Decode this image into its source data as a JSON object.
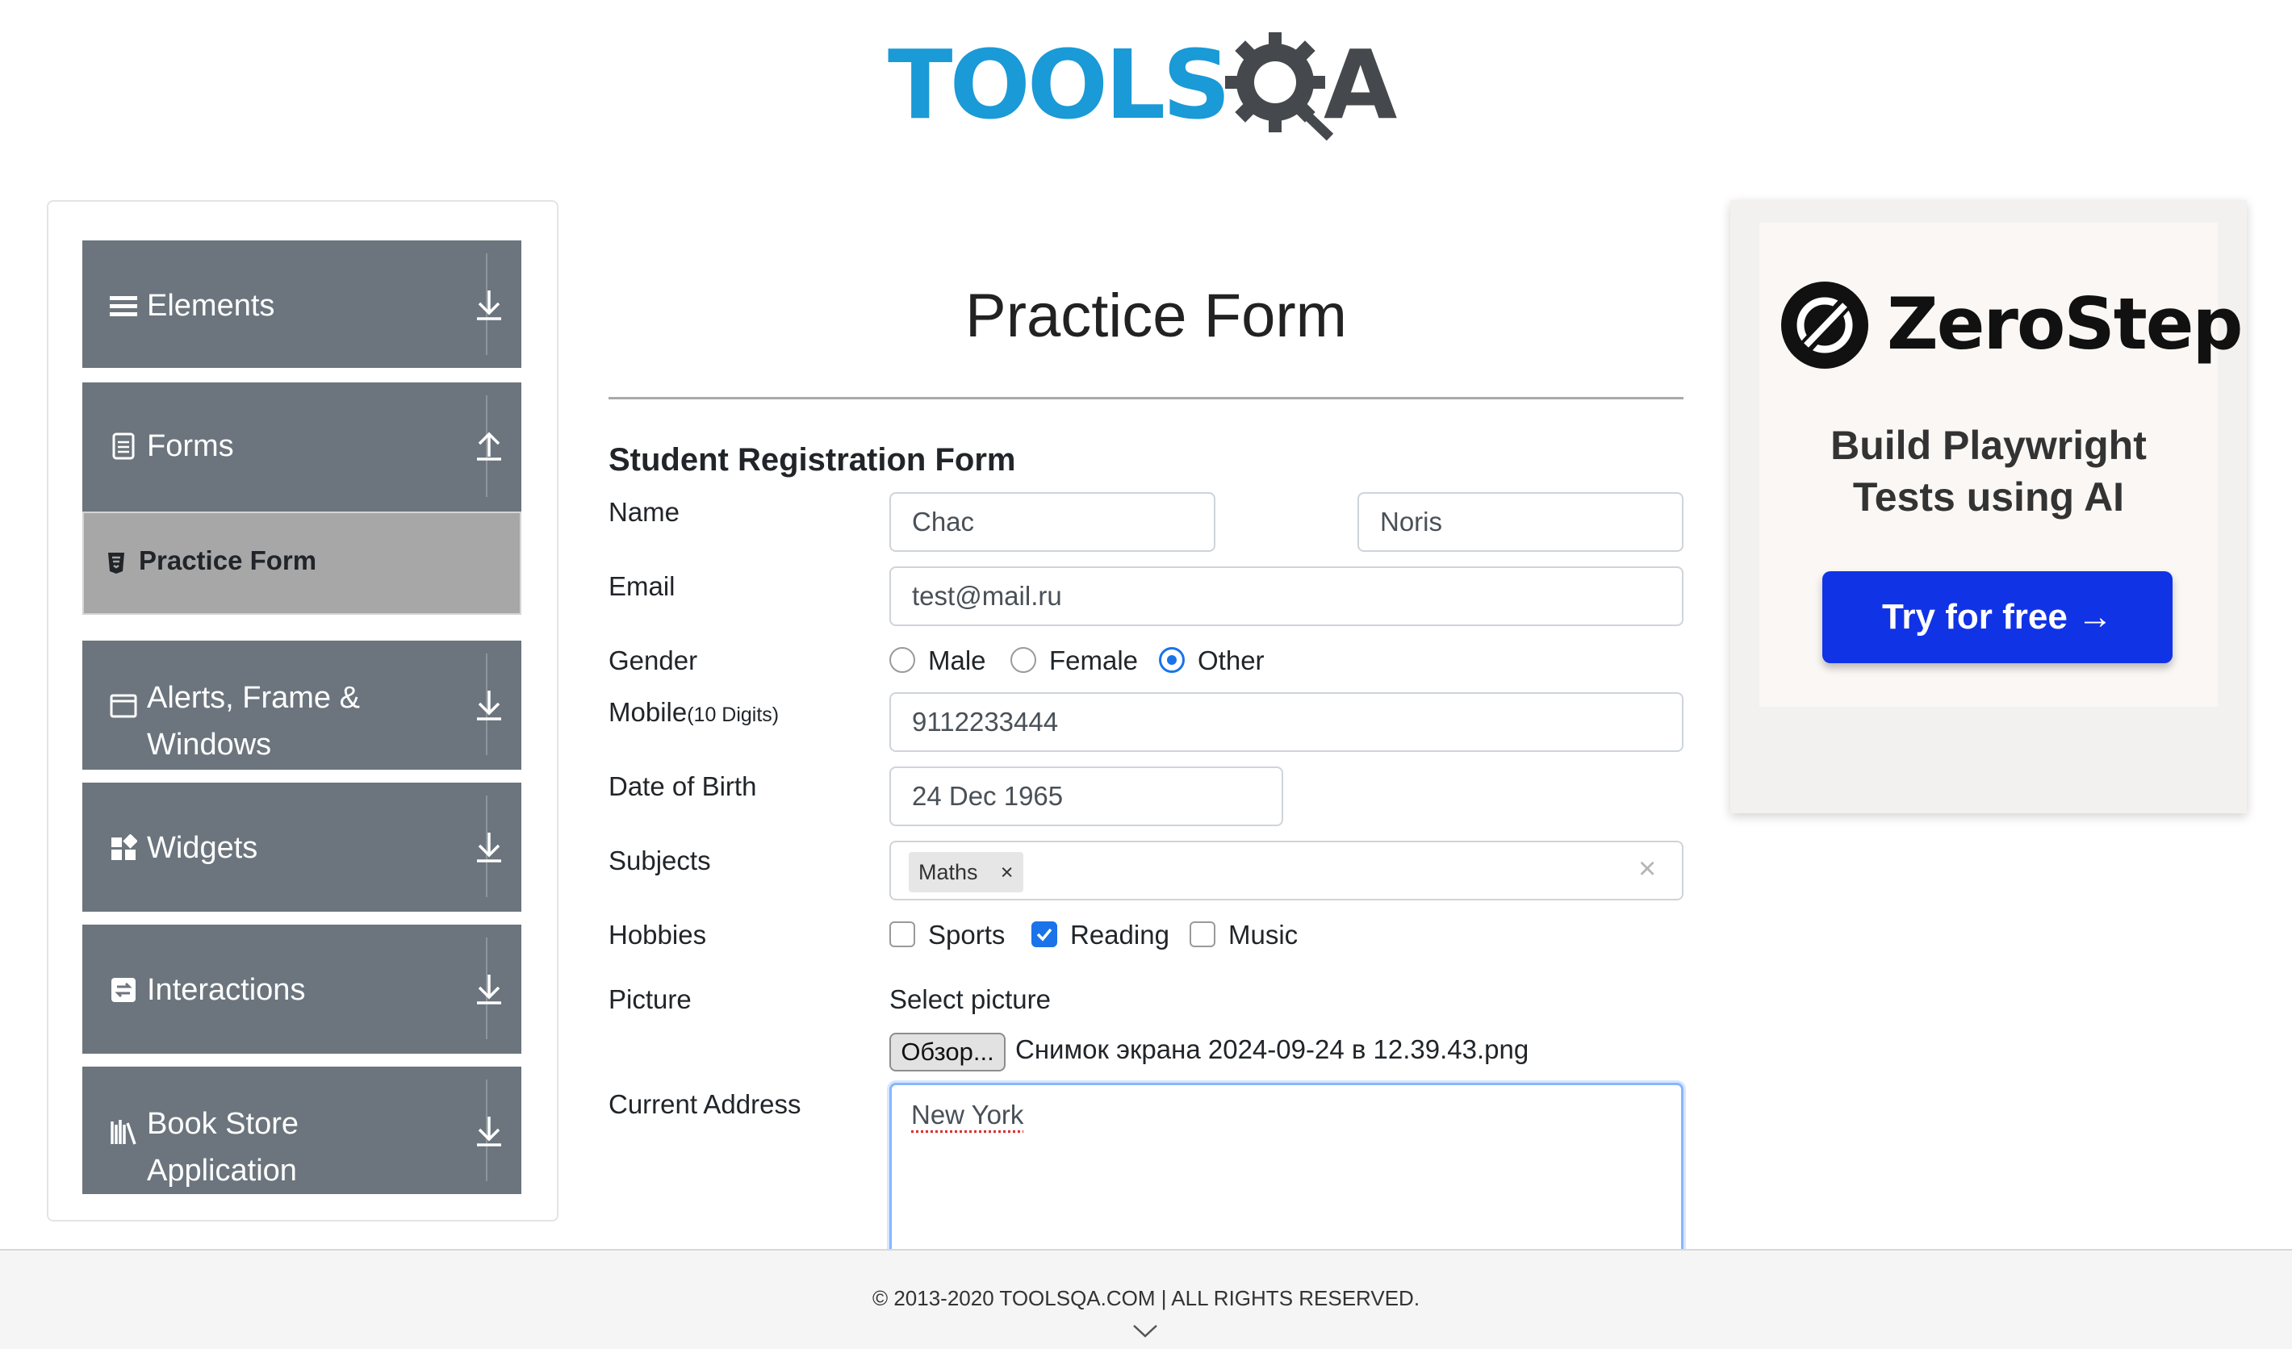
{
  "header": {
    "logo_text_left": "TOOLS",
    "logo_text_right": "A",
    "logo_alt": "TOOLSQA"
  },
  "sidebar": {
    "groups": [
      {
        "label": "Elements",
        "icon": "hamburger-icon",
        "state": "collapsed"
      },
      {
        "label": "Forms",
        "icon": "document-icon",
        "state": "expanded"
      },
      {
        "label": "Alerts, Frame &",
        "label2": "Windows",
        "icon": "window-icon",
        "state": "collapsed"
      },
      {
        "label": "Widgets",
        "icon": "widgets-icon",
        "state": "collapsed"
      },
      {
        "label": "Interactions",
        "icon": "interactions-icon",
        "state": "collapsed"
      },
      {
        "label": "Book Store",
        "label2": "Application",
        "icon": "books-icon",
        "state": "collapsed"
      }
    ],
    "forms_items": [
      {
        "label": "Practice Form",
        "active": true
      }
    ]
  },
  "form": {
    "title": "Practice Form",
    "subtitle": "Student Registration Form",
    "name_label": "Name",
    "first_name": "Chac",
    "last_name": "Noris",
    "email_label": "Email",
    "email": "test@mail.ru",
    "gender_label": "Gender",
    "gender_options": [
      "Male",
      "Female",
      "Other"
    ],
    "gender_selected": "Other",
    "mobile_label": "Mobile",
    "mobile_hint": "(10 Digits)",
    "mobile": "9112233444",
    "dob_label": "Date of Birth",
    "dob": "24 Dec 1965",
    "subjects_label": "Subjects",
    "subjects": [
      "Maths"
    ],
    "hobbies_label": "Hobbies",
    "hobbies": [
      {
        "label": "Sports",
        "checked": false
      },
      {
        "label": "Reading",
        "checked": true
      },
      {
        "label": "Music",
        "checked": false
      }
    ],
    "picture_label": "Picture",
    "picture_prompt": "Select picture",
    "browse_label": "Обзор...",
    "file_name": "Снимок экрана 2024-09-24 в 12.39.43.png",
    "address_label": "Current Address",
    "address": "New York"
  },
  "ad": {
    "brand": "ZeroStep",
    "tagline_line1": "Build Playwright",
    "tagline_line2": "Tests using AI",
    "cta": "Try for free →"
  },
  "footer": {
    "copyright": "© 2013-2020 TOOLSQA.COM | ALL RIGHTS RESERVED."
  },
  "colors": {
    "sidebar_bg": "#6c757d",
    "accent": "#1a73e8",
    "logo_blue": "#1a9ad6",
    "ad_button": "#1133e6"
  }
}
